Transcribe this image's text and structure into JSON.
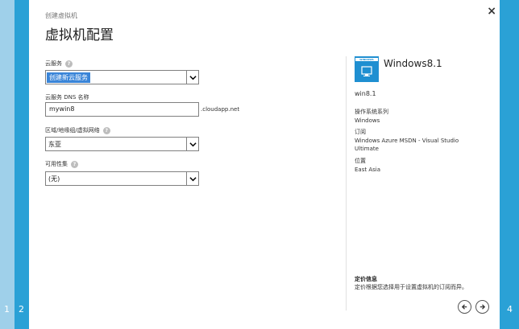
{
  "wizard": {
    "steps": [
      "1",
      "2",
      "4"
    ],
    "crumb": "创建虚拟机",
    "title": "虚拟机配置",
    "close_symbol": "×"
  },
  "form": {
    "cloud_service": {
      "label": "云服务",
      "value": "创建新云服务"
    },
    "dns_name": {
      "label": "云服务 DNS 名称",
      "value": "mywin8",
      "suffix": ".cloudapp.net"
    },
    "region": {
      "label": "区域/地缘组/虚拟网络",
      "value": "东亚"
    },
    "availability_set": {
      "label": "可用性集",
      "value": "(无)"
    }
  },
  "summary": {
    "image_tag": "WINDOWS",
    "image_name": "Windows8.1",
    "vm_name": "win8.1",
    "os_family_label": "操作系统系列",
    "os_family_value": "Windows",
    "subscription_label": "订阅",
    "subscription_value": "Windows Azure MSDN - Visual Studio Ultimate",
    "location_label": "位置",
    "location_value": "East Asia",
    "pricing_title": "定价信息",
    "pricing_desc": "定价根据您选择用于设置虚拟机的订阅而异。"
  },
  "colors": {
    "accent": "#2aa1d6",
    "selected": "#3a85d8"
  },
  "icons": {
    "help": "help-icon",
    "dropdown": "chevron-down-icon",
    "back": "arrow-left-icon",
    "next": "arrow-right-icon",
    "close": "close-icon"
  }
}
